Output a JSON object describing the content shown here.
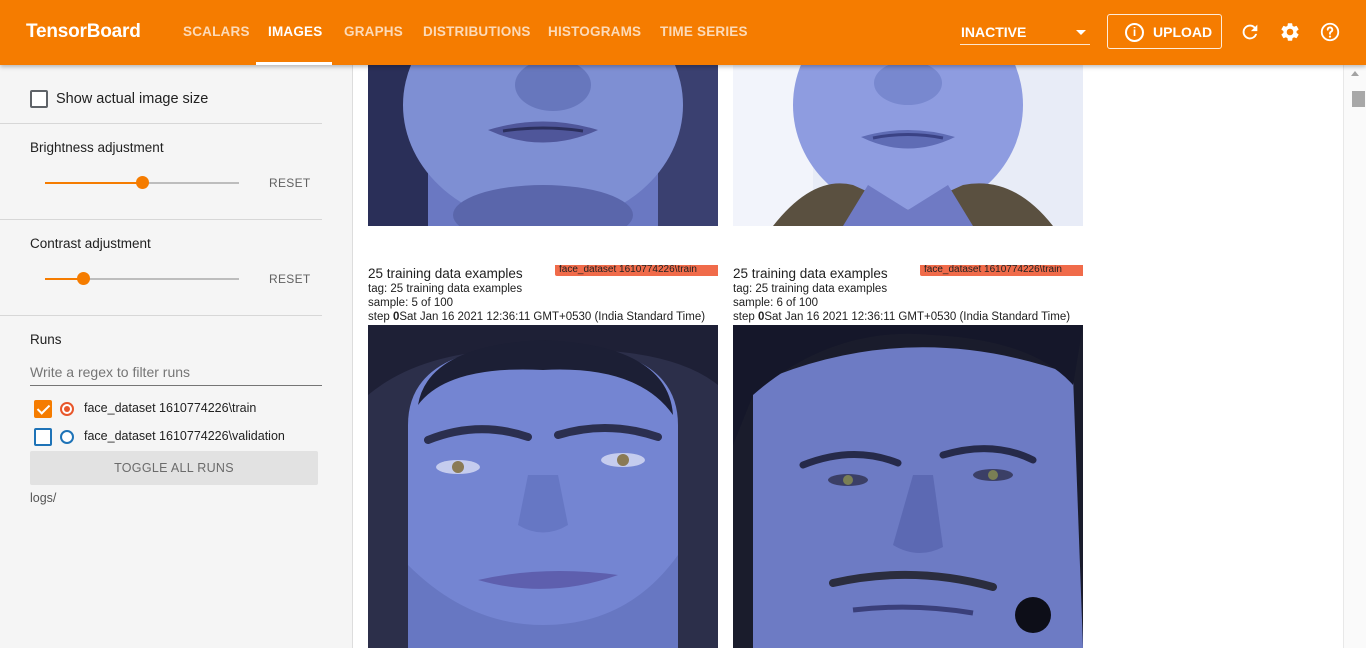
{
  "app": {
    "title": "TensorBoard"
  },
  "tabs": [
    {
      "label": "SCALARS",
      "active": false
    },
    {
      "label": "IMAGES",
      "active": true
    },
    {
      "label": "GRAPHS",
      "active": false
    },
    {
      "label": "DISTRIBUTIONS",
      "active": false
    },
    {
      "label": "HISTOGRAMS",
      "active": false
    },
    {
      "label": "TIME SERIES",
      "active": false
    }
  ],
  "toolbar": {
    "status_select": "INACTIVE",
    "upload_label": "UPLOAD",
    "upload_icon": "info-icon",
    "icons": [
      "refresh-icon",
      "settings-icon",
      "help-icon"
    ]
  },
  "sidebar": {
    "show_actual_size": {
      "label": "Show actual image size",
      "checked": false
    },
    "brightness": {
      "label": "Brightness adjustment",
      "value": 0.5,
      "reset": "RESET"
    },
    "contrast": {
      "label": "Contrast adjustment",
      "value": 0.2,
      "reset": "RESET"
    },
    "runs": {
      "title": "Runs",
      "filter_placeholder": "Write a regex to filter runs",
      "items": [
        {
          "label": "face_dataset 1610774226\\train",
          "checked": true,
          "color": "#e8572b"
        },
        {
          "label": "face_dataset 1610774226\\validation",
          "checked": false,
          "color": "#1e73b7"
        }
      ],
      "toggle_all": "TOGGLE ALL RUNS",
      "logdir": "logs/"
    }
  },
  "cards": [
    {
      "title": "25 training data examples",
      "run": "face_dataset 1610774226\\train",
      "tag": "tag: 25 training data examples",
      "sample": "sample: 5 of 100",
      "step_label": "step",
      "step": "0",
      "time": "Sat Jan 16 2021 12:36:11 GMT+0530 (India Standard Time)"
    },
    {
      "title": "25 training data examples",
      "run": "face_dataset 1610774226\\train",
      "tag": "tag: 25 training data examples",
      "sample": "sample: 6 of 100",
      "step_label": "step",
      "step": "0",
      "time": "Sat Jan 16 2021 12:36:11 GMT+0530 (India Standard Time)"
    }
  ],
  "colors": {
    "accent": "#f57c00",
    "run_train": "#e8572b",
    "run_validation": "#1e73b7"
  }
}
